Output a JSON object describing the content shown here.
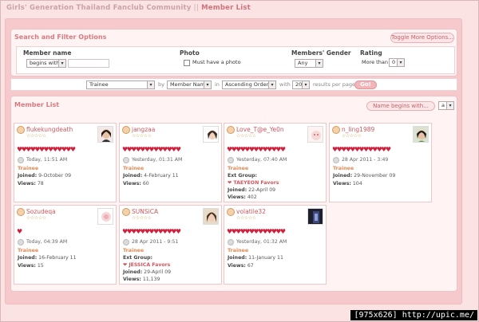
{
  "breadcrumb": {
    "site": "Girls' Generation Thailand Fanclub Community",
    "current": "Member List"
  },
  "search": {
    "title": "Search and Filter Options",
    "toggle_label": "Toggle More Options...",
    "member_name": {
      "label": "Member name",
      "mode": "begins with"
    },
    "photo": {
      "label": "Photo",
      "checkbox_label": "Must have a photo"
    },
    "gender": {
      "label": "Members' Gender",
      "value": "Any"
    },
    "rating": {
      "label": "Rating",
      "more_than": "More than",
      "value": "0"
    }
  },
  "sortbar": {
    "group_value": "Trainee",
    "by_label": "by",
    "field_value": "Member Name",
    "in_label": "in",
    "order_value": "Ascending Order",
    "with_label": "with",
    "per_page_value": "20",
    "results_label": "results per page",
    "go_label": "Go!"
  },
  "member_list": {
    "title": "Member List",
    "name_begins_label": "Name begins with...",
    "letter_value": "a",
    "members": [
      {
        "name": "flukekungdeath",
        "stars": "☆☆☆☆☆",
        "hearts": "♥♥♥♥♥♥♥♥♥♥♥♥♥",
        "last": "Today, 11:51 AM",
        "rank": "Trainee",
        "joined_label": "Joined:",
        "joined": "9-October 09",
        "views_label": "Views:",
        "views": "78"
      },
      {
        "name": "jangzaa",
        "stars": "☆☆☆☆☆",
        "hearts": "♥♥♥♥♥♥♥♥♥♥♥♥♥",
        "last": "Yesterday, 01:31 AM",
        "rank": "Trainee",
        "joined_label": "Joined:",
        "joined": "4-February 11",
        "views_label": "Views:",
        "views": "60"
      },
      {
        "name": "Love_T@e_Ye0n",
        "stars": "☆☆☆☆☆",
        "hearts": "♥♥♥♥♥♥♥♥♥♥♥♥♥",
        "last": "Yesterday, 07:40 AM",
        "rank": "Trainee",
        "ext_group": "Ext Group:",
        "favor": "TAEYEON Favors",
        "joined_label": "Joined:",
        "joined": "22-April 09",
        "views_label": "Views:",
        "views": "402"
      },
      {
        "name": "n_ling1989",
        "stars": "☆☆☆☆☆",
        "hearts": "♥♥♥♥♥♥♥♥♥♥♥♥♥",
        "last": "28 Apr 2011 - 3:49",
        "rank": "Trainee",
        "joined_label": "Joined:",
        "joined": "29-November 09",
        "views_label": "Views:",
        "views": "104"
      },
      {
        "name": "Sozudeqa",
        "stars": "☆☆☆☆☆",
        "hearts": "♥",
        "last": "Today, 04:39 AM",
        "rank": "Trainee",
        "joined_label": "Joined:",
        "joined": "16-February 11",
        "views_label": "Views:",
        "views": "15"
      },
      {
        "name": "SUNSiCA",
        "stars": "☆☆☆☆☆",
        "hearts": "♥♥♥♥♥♥♥♥♥♥♥♥♥",
        "last": "28 Apr 2011 - 9:51",
        "rank": "Trainee",
        "ext_group": "Ext Group:",
        "favor": "JESSICA Favors",
        "joined_label": "Joined:",
        "joined": "29-April 09",
        "views_label": "Views:",
        "views": "11,139"
      },
      {
        "name": "volatile32",
        "stars": "☆☆☆☆☆",
        "hearts": "♥♥♥♥♥♥♥♥♥♥♥♥♥",
        "last": "Yesterday, 01:32 AM",
        "rank": "Trainee",
        "joined_label": "Joined:",
        "joined": "11-January 11",
        "views_label": "Views:",
        "views": "67"
      }
    ]
  },
  "watermark": "[975x626] http://upic.me/",
  "colors": {
    "page_bg": "#fbe3e4",
    "panel_bg": "#fff3f3",
    "accent": "#d97980",
    "heart": "#d11f3c"
  }
}
